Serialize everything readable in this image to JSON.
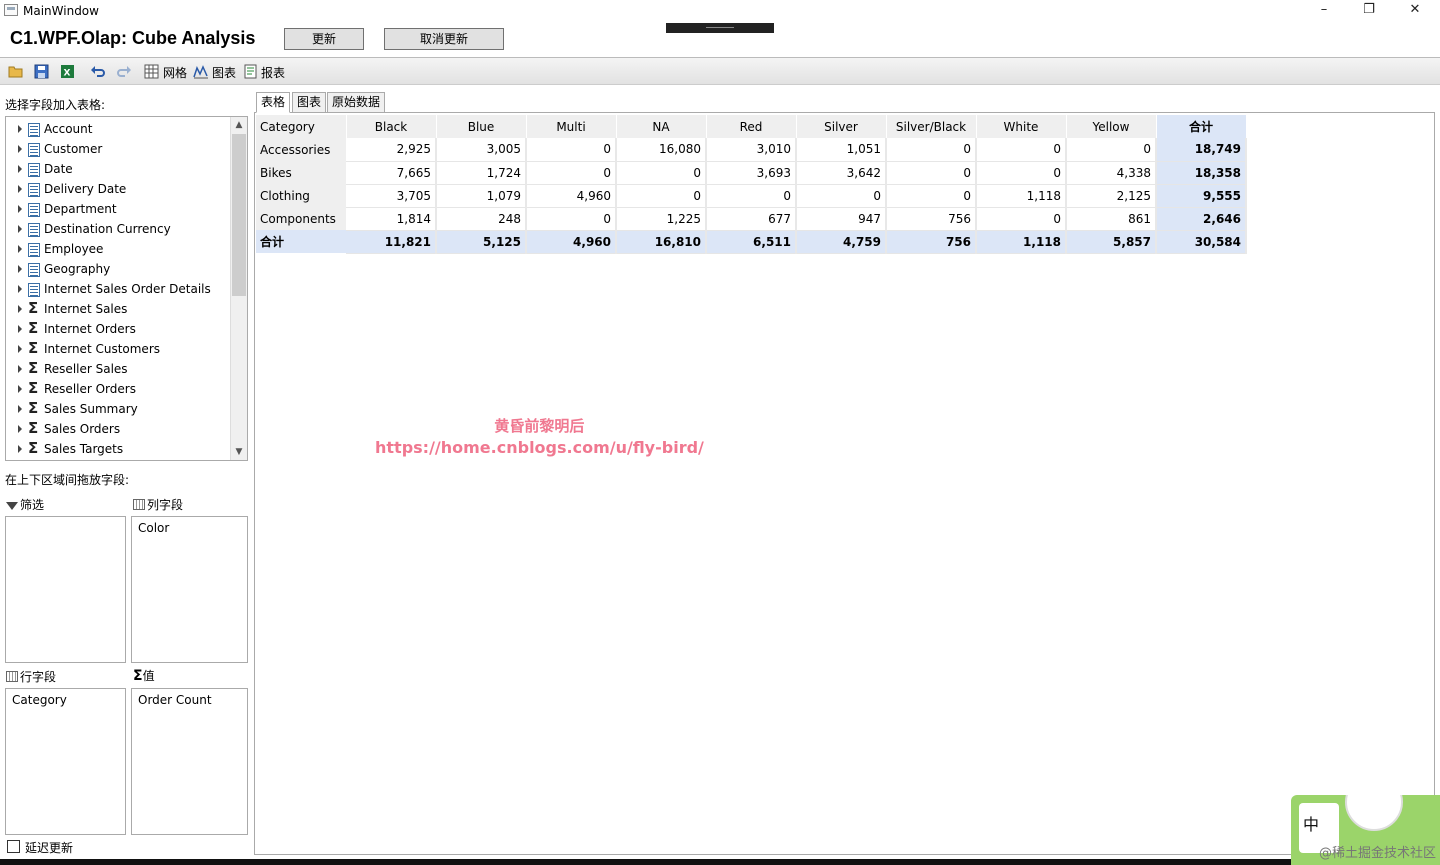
{
  "window": {
    "title": "MainWindow",
    "controls": [
      "–",
      "❐",
      "✕"
    ]
  },
  "header": {
    "title": "C1.WPF.Olap: Cube Analysis",
    "update_label": "更新",
    "cancel_update_label": "取消更新"
  },
  "toolbar": {
    "grid_label": "网格",
    "chart_label": "图表",
    "report_label": "报表"
  },
  "left_panel": {
    "field_list_label": "选择字段加入表格:",
    "fields": [
      {
        "label": "Account",
        "kind": "table"
      },
      {
        "label": "Customer",
        "kind": "table"
      },
      {
        "label": "Date",
        "kind": "table"
      },
      {
        "label": "Delivery Date",
        "kind": "table"
      },
      {
        "label": "Department",
        "kind": "table"
      },
      {
        "label": "Destination Currency",
        "kind": "table"
      },
      {
        "label": "Employee",
        "kind": "table"
      },
      {
        "label": "Geography",
        "kind": "table"
      },
      {
        "label": "Internet Sales Order Details",
        "kind": "table"
      },
      {
        "label": "Internet Sales",
        "kind": "measure"
      },
      {
        "label": "Internet Orders",
        "kind": "measure"
      },
      {
        "label": "Internet Customers",
        "kind": "measure"
      },
      {
        "label": "Reseller Sales",
        "kind": "measure"
      },
      {
        "label": "Reseller Orders",
        "kind": "measure"
      },
      {
        "label": "Sales Summary",
        "kind": "measure"
      },
      {
        "label": "Sales Orders",
        "kind": "measure"
      },
      {
        "label": "Sales Targets",
        "kind": "measure"
      }
    ],
    "drag_label": "在上下区域间拖放字段:",
    "filter_label": "筛选",
    "column_fields_label": "列字段",
    "row_fields_label": "行字段",
    "values_label": "值",
    "column_field": "Color",
    "row_field": "Category",
    "value_field": "Order Count",
    "defer_update_label": "延迟更新"
  },
  "tabs": [
    "表格",
    "图表",
    "原始数据"
  ],
  "grid": {
    "corner": "Category",
    "columns": [
      "Black",
      "Blue",
      "Multi",
      "NA",
      "Red",
      "Silver",
      "Silver/Black",
      "White",
      "Yellow",
      "合计"
    ],
    "rows": [
      {
        "label": "Accessories",
        "values": [
          "2,925",
          "3,005",
          "0",
          "16,080",
          "3,010",
          "1,051",
          "0",
          "0",
          "0",
          "18,749"
        ]
      },
      {
        "label": "Bikes",
        "values": [
          "7,665",
          "1,724",
          "0",
          "0",
          "3,693",
          "3,642",
          "0",
          "0",
          "4,338",
          "18,358"
        ]
      },
      {
        "label": "Clothing",
        "values": [
          "3,705",
          "1,079",
          "4,960",
          "0",
          "0",
          "0",
          "0",
          "1,118",
          "2,125",
          "9,555"
        ]
      },
      {
        "label": "Components",
        "values": [
          "1,814",
          "248",
          "0",
          "1,225",
          "677",
          "947",
          "756",
          "0",
          "861",
          "2,646"
        ]
      }
    ],
    "total": {
      "label": "合计",
      "values": [
        "11,821",
        "5,125",
        "4,960",
        "16,810",
        "6,511",
        "4,759",
        "756",
        "1,118",
        "5,857",
        "30,584"
      ]
    }
  },
  "watermark": {
    "line1": "黄昏前黎明后",
    "line2": "https://home.cnblogs.com/u/fly-bird/"
  },
  "ime": {
    "mode": "中",
    "credit": "@稀土掘金技术社区"
  }
}
